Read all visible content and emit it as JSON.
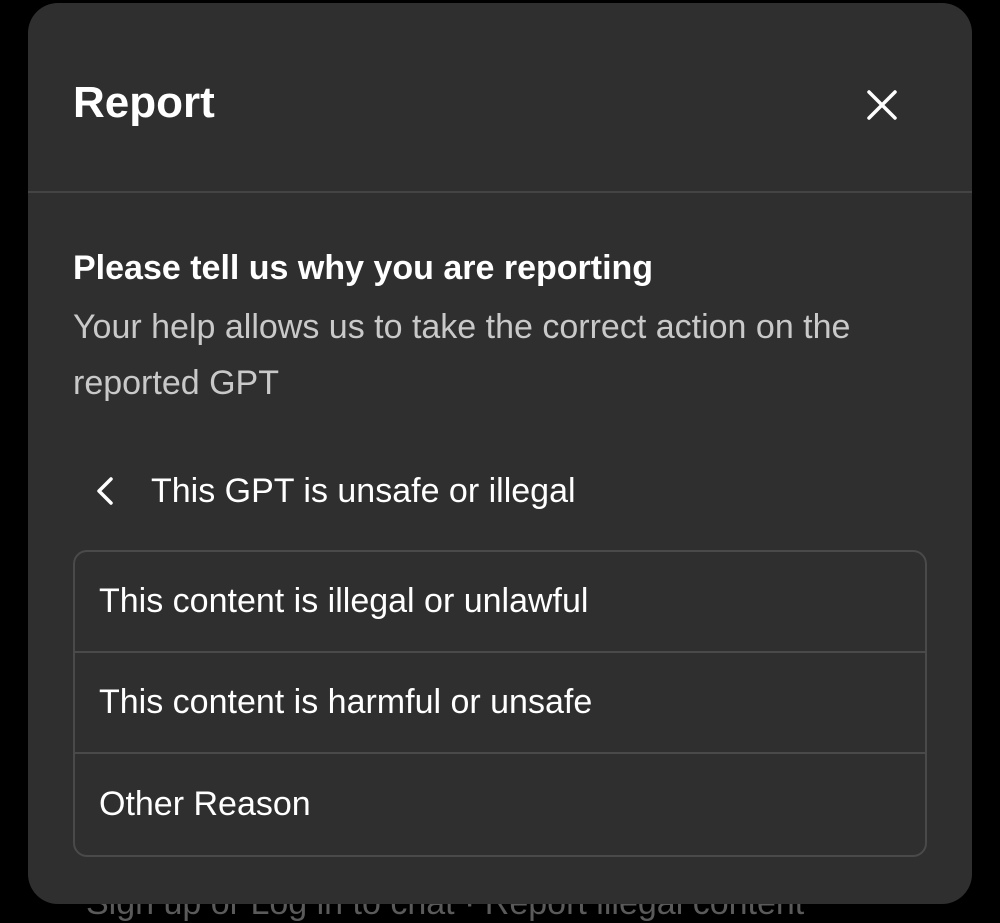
{
  "background": {
    "text": "Sign up or Log in to chat · Report illegal content"
  },
  "modal": {
    "title": "Report",
    "close_icon": "close-icon",
    "heading": "Please tell us why you are reporting",
    "description": "Your help allows us to take the correct action on the reported GPT",
    "back": {
      "icon": "chevron-left-icon",
      "label": "This GPT is unsafe or illegal"
    },
    "options": [
      {
        "label": "This content is illegal or unlawful"
      },
      {
        "label": "This content is harmful or unsafe"
      },
      {
        "label": "Other Reason"
      }
    ]
  },
  "colors": {
    "page_background": "#000000",
    "modal_background": "#2f2f2f",
    "border": "#4a4a4a",
    "text_primary": "#ffffff",
    "text_secondary": "#c9c9c9"
  }
}
